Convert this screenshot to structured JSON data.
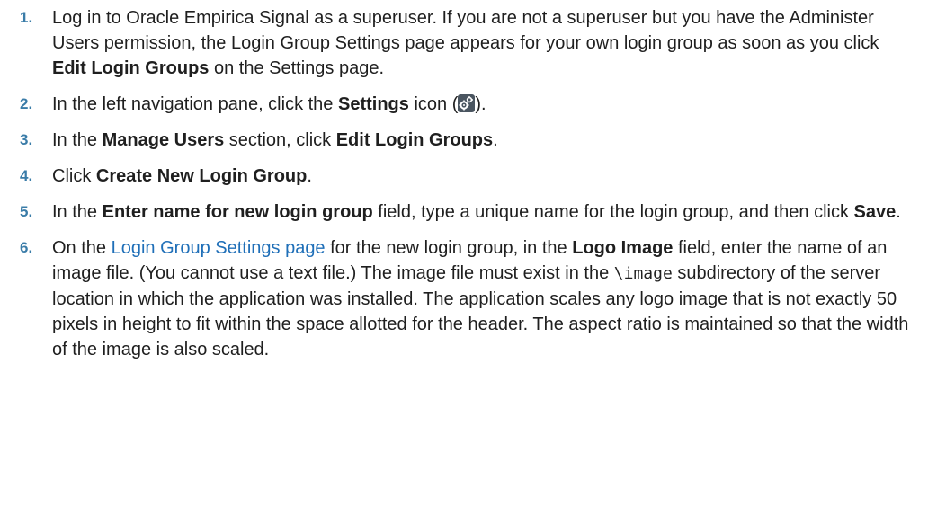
{
  "steps": [
    {
      "num": "1.",
      "t1": "Log in to Oracle Empirica Signal as a superuser. If you are not a superuser but you have the Administer Users permission, the Login Group Settings page appears for your own login group as soon as you click ",
      "b1": "Edit Login Groups",
      "t2": " on the Settings page."
    },
    {
      "num": "2.",
      "t1": "In the left navigation pane, click the ",
      "b1": "Settings",
      "t2": " icon (",
      "t3": ")."
    },
    {
      "num": "3.",
      "t1": "In the ",
      "b1": "Manage Users",
      "t2": " section, click ",
      "b2": "Edit Login Groups",
      "t3": "."
    },
    {
      "num": "4.",
      "t1": "Click ",
      "b1": "Create New Login Group",
      "t2": "."
    },
    {
      "num": "5.",
      "t1": "In the ",
      "b1": "Enter name for new login group",
      "t2": " field, type a unique name for the login group, and then click ",
      "b2": "Save",
      "t3": "."
    },
    {
      "num": "6.",
      "t1": "On the ",
      "link": "Login Group Settings page",
      "t2": " for the new login group, in the ",
      "b1": "Logo Image",
      "t3": " field, enter the name of an image file. (You cannot use a text file.) The image file must exist in the ",
      "code": "\\image",
      "t4": " subdirectory of the server location in which the application was installed. The application scales any logo image that is not exactly 50 pixels in height to fit within the space allotted for the header. The aspect ratio is maintained so that the width of the image is also scaled."
    }
  ],
  "icons": {
    "settings": "settings-gear-icon"
  }
}
